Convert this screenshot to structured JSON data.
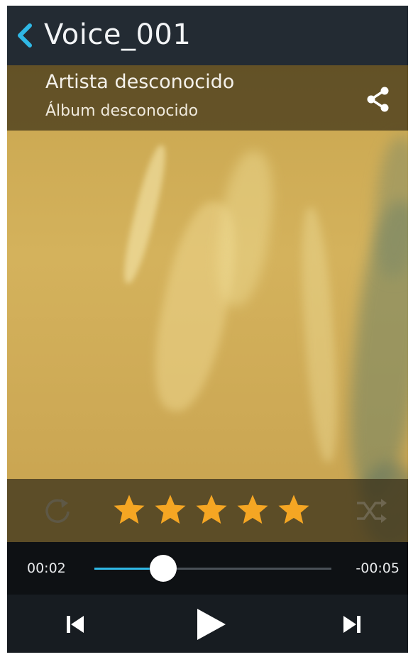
{
  "header": {
    "title": "Voice_001",
    "back_icon": "chevron-left-icon",
    "accent_color": "#2fb8e6"
  },
  "track_info": {
    "artist": "Artista desconocido",
    "album": "Álbum desconocido",
    "share_icon": "share-icon"
  },
  "rating": {
    "stars": 5,
    "max": 5,
    "star_color": "#f5a623",
    "repeat_icon": "repeat-icon",
    "shuffle_icon": "shuffle-icon"
  },
  "playback": {
    "elapsed": "00:02",
    "remaining": "-00:05",
    "progress_fraction": 0.29
  },
  "controls": {
    "prev_icon": "skip-previous-icon",
    "play_icon": "play-icon",
    "next_icon": "skip-next-icon"
  }
}
